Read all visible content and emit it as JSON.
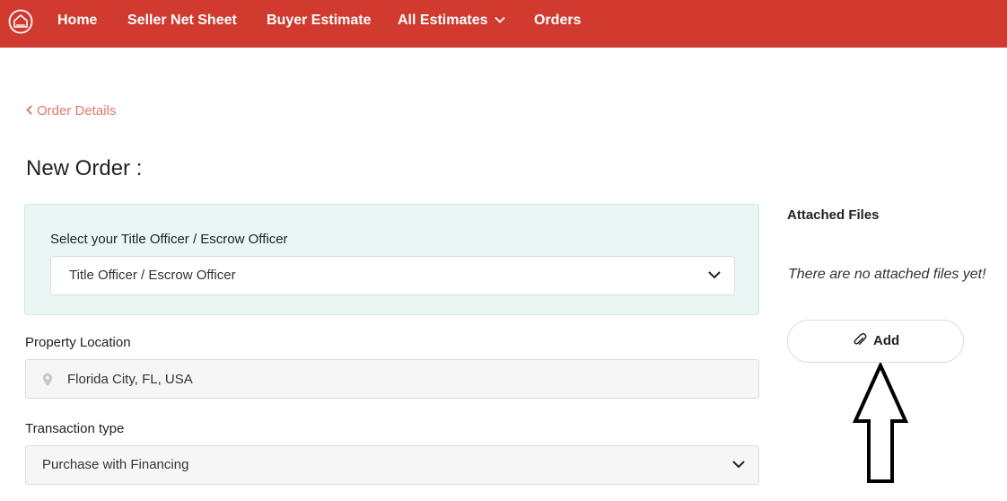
{
  "nav": {
    "home": "Home",
    "seller_net_sheet": "Seller Net Sheet",
    "buyer_estimate": "Buyer Estimate",
    "all_estimates": "All Estimates",
    "orders": "Orders"
  },
  "back_link": "Order Details",
  "page_title": "New Order :",
  "officer": {
    "label": "Select your Title Officer / Escrow Officer",
    "selected": "Title Officer / Escrow Officer"
  },
  "property_location": {
    "label": "Property Location",
    "value": "Florida City, FL, USA"
  },
  "transaction_type": {
    "label": "Transaction type",
    "selected": "Purchase with Financing"
  },
  "attachments": {
    "title": "Attached Files",
    "empty_message": "There are no attached files yet!",
    "add_label": "Add"
  },
  "colors": {
    "brand_red": "#d13a2f",
    "link_salmon": "#e0796f",
    "officer_panel_bg": "#e9f6f3"
  },
  "icons": {
    "logo": "house-circle-logo-icon",
    "nav_dropdown": "chevron-down-icon",
    "back": "chevron-left-icon",
    "select_dropdown": "chevron-down-icon",
    "location": "map-pin-icon",
    "attach": "paperclip-icon",
    "annotation": "up-arrow-icon"
  }
}
